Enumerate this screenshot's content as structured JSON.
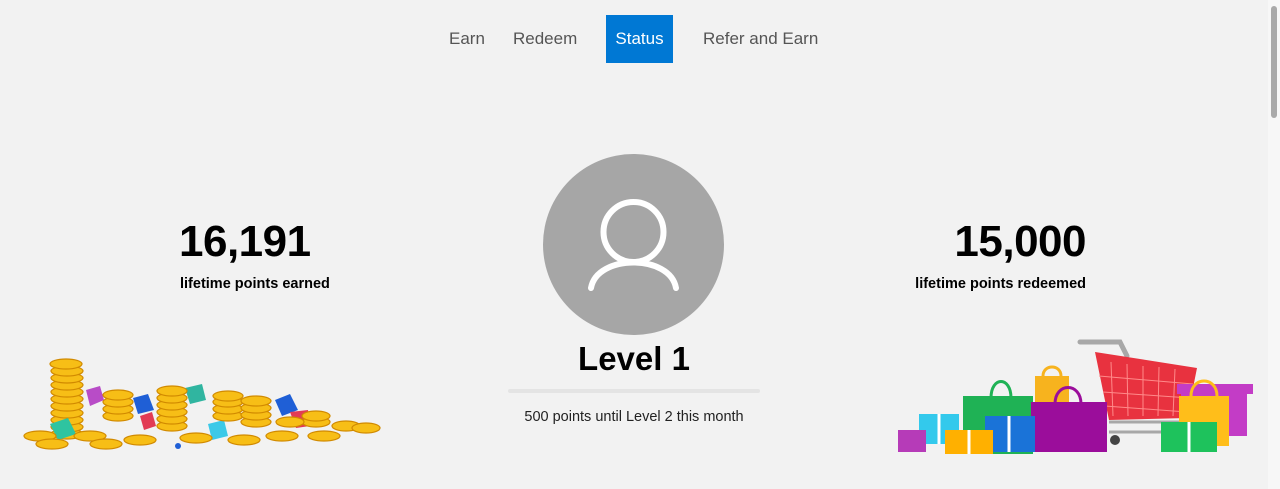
{
  "nav": {
    "tabs": [
      {
        "label": "Earn",
        "active": false
      },
      {
        "label": "Redeem",
        "active": false
      },
      {
        "label": "Status",
        "active": true
      },
      {
        "label": "Refer and Earn",
        "active": false
      }
    ],
    "accent_color": "#0078d4"
  },
  "stats": {
    "earned": {
      "value": "16,191",
      "label": "lifetime points earned"
    },
    "redeemed": {
      "value": "15,000",
      "label": "lifetime points redeemed"
    }
  },
  "level": {
    "title": "Level 1",
    "progress_fraction": 0.0,
    "note": "500 points until Level 2 this month"
  },
  "icons": {
    "avatar": "user-avatar-icon",
    "coins": "coins-gems-illustration",
    "shopping": "shopping-bags-cart-illustration"
  }
}
